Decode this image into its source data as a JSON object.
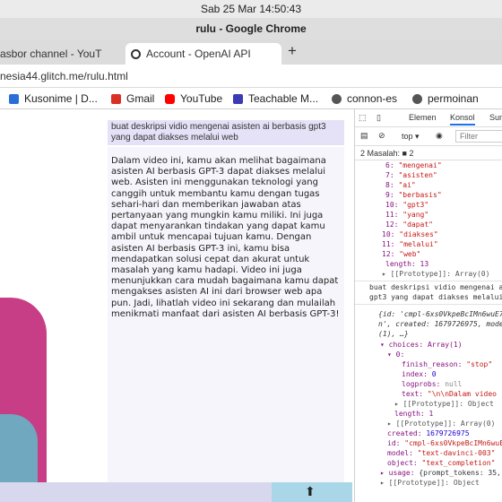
{
  "system": {
    "clock": "Sab 25 Mar  14:50:43"
  },
  "window": {
    "title": "rulu - Google Chrome"
  },
  "tabs": [
    {
      "label": "asbor channel - YouT",
      "active": false
    },
    {
      "label": "Account - OpenAI API",
      "active": true
    }
  ],
  "omnibox": {
    "url": "nesia44.glitch.me/rulu.html"
  },
  "bookmarks": [
    {
      "label": "Kusonime | D...",
      "icon": "kusonime-icon",
      "color": "#2a6fd6"
    },
    {
      "label": "Gmail",
      "icon": "gmail-icon",
      "color": "#d93025"
    },
    {
      "label": "YouTube",
      "icon": "youtube-icon",
      "color": "#ff0000"
    },
    {
      "label": "Teachable M...",
      "icon": "teachable-icon",
      "color": "#3b3bb3"
    },
    {
      "label": "connon-es",
      "icon": "globe-icon",
      "color": "#555555"
    },
    {
      "label": "permoinan",
      "icon": "globe-icon",
      "color": "#555555"
    }
  ],
  "page": {
    "prompt": "buat deskripsi vidio mengenai asisten ai berbasis gpt3 yang dapat diakses melalui web",
    "answer": "Dalam video ini, kamu akan melihat bagaimana asisten AI berbasis GPT-3 dapat diakses melalui web. Asisten ini menggunakan teknologi yang canggih untuk membantu kamu dengan tugas sehari-hari dan memberikan jawaban atas pertanyaan yang mungkin kamu miliki. Ini juga dapat menyarankan tindakan yang dapat kamu ambil untuk mencapai tujuan kamu. Dengan asisten AI berbasis GPT-3 ini, kamu bisa mendapatkan solusi cepat dan akurat untuk masalah yang kamu hadapi. Video ini juga menunjukkan cara mudah bagaimana kamu dapat mengakses asisten AI ini dari browser web apa pun. Jadi, lihatlah video ini sekarang dan mulailah menikmati manfaat dari asisten AI berbasis GPT-3!"
  },
  "devtools": {
    "tabs": [
      "Elemen",
      "Konsol",
      "Sum"
    ],
    "active_tab": "Konsol",
    "context": "top",
    "filter_placeholder": "Filter",
    "issues": "2 Masalah: ■ 2",
    "array_items": [
      {
        "idx": "6:",
        "val": "\"mengenai\""
      },
      {
        "idx": "7:",
        "val": "\"asisten\""
      },
      {
        "idx": "8:",
        "val": "\"ai\""
      },
      {
        "idx": "9:",
        "val": "\"berbasis\""
      },
      {
        "idx": "10:",
        "val": "\"gpt3\""
      },
      {
        "idx": "11:",
        "val": "\"yang\""
      },
      {
        "idx": "12:",
        "val": "\"dapat\""
      },
      {
        "idx": "10:",
        "val": "\"diakses\""
      },
      {
        "idx": "11:",
        "val": "\"melalui\""
      },
      {
        "idx": "12:",
        "val": "\"web\""
      }
    ],
    "length_line": "length: 13",
    "proto_array": "▸ [[Prototype]]: Array(0)",
    "log_text_1": "buat deskripsi vidio mengenai a",
    "log_text_2": "gpt3 yang dapat diakses melalui",
    "obj_line_1": "{id: 'cmpl-6xs0VkpeBcIMn6wuE7",
    "obj_line_2": "n', created: 1679726975, mode",
    "obj_line_3": "(1), …}",
    "choices_line": "▾ choices: Array(1)",
    "zero_line": "▾ 0:",
    "finish_reason": {
      "key": "finish_reason:",
      "val": "\"stop\""
    },
    "index": {
      "key": "index:",
      "val": "0"
    },
    "logprobs": {
      "key": "logprobs:",
      "val": "null"
    },
    "text": {
      "key": "text:",
      "val": "\"\\n\\nDalam video"
    },
    "proto_object": "▸ [[Prototype]]: Object",
    "length1": "length: 1",
    "proto_array2": "▸ [[Prototype]]: Array(0)",
    "created": {
      "key": "created:",
      "val": "1679726975"
    },
    "id": {
      "key": "id:",
      "val": "\"cmpl-6xs0VkpeBcIMn6wuE"
    },
    "model": {
      "key": "model:",
      "val": "\"text-davinci-003\""
    },
    "object": {
      "key": "object:",
      "val": "\"text_completion\""
    },
    "usage": {
      "key": "▸ usage:",
      "val": "{prompt_tokens: 35,"
    },
    "proto_object2": "▸ [[Prototype]]: Object"
  }
}
